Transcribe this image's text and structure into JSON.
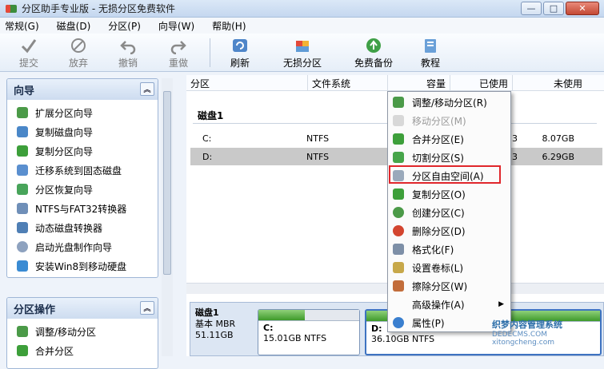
{
  "window": {
    "title": "分区助手专业版 - 无损分区免费软件",
    "min": "—",
    "max": "□",
    "close": "✕"
  },
  "menu": [
    "常规(G)",
    "磁盘(D)",
    "分区(P)",
    "向导(W)",
    "帮助(H)"
  ],
  "toolbar": {
    "submit": "提交",
    "discard": "放弃",
    "undo": "撤销",
    "redo": "重做",
    "refresh": "刷新",
    "lossless": "无损分区",
    "backup": "免费备份",
    "tutorial": "教程"
  },
  "wizard": {
    "title": "向导",
    "items": [
      "扩展分区向导",
      "复制磁盘向导",
      "复制分区向导",
      "迁移系统到固态磁盘",
      "分区恢复向导",
      "NTFS与FAT32转换器",
      "动态磁盘转换器",
      "启动光盘制作向导",
      "安装Win8到移动硬盘"
    ]
  },
  "partops": {
    "title": "分区操作",
    "items": [
      "调整/移动分区",
      "合并分区"
    ]
  },
  "table": {
    "headers": [
      "分区",
      "文件系统",
      "容量",
      "已使用",
      "未使用"
    ],
    "disk_label": "磁盘1",
    "rows": [
      {
        "name": "C:",
        "fs": "NTFS",
        "used_tail": "3",
        "free": "8.07GB"
      },
      {
        "name": "D:",
        "fs": "NTFS",
        "used_tail": "3",
        "free": "6.29GB"
      }
    ]
  },
  "diskmap": {
    "name": "磁盘1",
    "type": "基本 MBR",
    "size": "51.11GB",
    "c_label": "C:",
    "c_info": "15.01GB NTFS",
    "c_used": 0.46,
    "d_label": "D:",
    "d_info": "36.10GB NTFS"
  },
  "context_menu": [
    {
      "label": "调整/移动分区(R)",
      "enabled": true
    },
    {
      "label": "移动分区(M)",
      "enabled": false
    },
    {
      "label": "合并分区(E)",
      "enabled": true
    },
    {
      "label": "切割分区(S)",
      "enabled": true
    },
    {
      "label": "分区自由空间(A)",
      "enabled": true
    },
    {
      "label": "复制分区(O)",
      "enabled": true
    },
    {
      "label": "创建分区(C)",
      "enabled": true
    },
    {
      "label": "删除分区(D)",
      "enabled": true
    },
    {
      "label": "格式化(F)",
      "enabled": true
    },
    {
      "label": "设置卷标(L)",
      "enabled": true
    },
    {
      "label": "擦除分区(W)",
      "enabled": true
    },
    {
      "label": "高级操作(A)",
      "enabled": true
    },
    {
      "label": "属性(P)",
      "enabled": true
    }
  ],
  "watermark": {
    "main": "织梦内容管理系统",
    "sub": "DEDECMS.COM",
    "url": "xitongcheng.com"
  }
}
